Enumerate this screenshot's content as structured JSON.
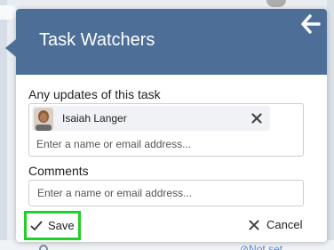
{
  "header": {
    "title": "Task Watchers",
    "back_icon": "arrow-left-icon"
  },
  "watchers": {
    "label": "Any updates of this task",
    "people": [
      {
        "name": "Isaiah Langer",
        "avatar_icon": "user-avatar",
        "remove_icon": "close-icon"
      }
    ],
    "input_placeholder": "Enter a name or email address...",
    "input_value": ""
  },
  "comments": {
    "label": "Comments",
    "placeholder": "Enter a name or email address...",
    "value": ""
  },
  "actions": {
    "save_label": "Save",
    "save_icon": "checkmark-icon",
    "cancel_label": "Cancel",
    "cancel_icon": "close-icon"
  },
  "background": {
    "bottom_link_text": "⊘Not set"
  },
  "colors": {
    "header_bg": "#4d6f97",
    "header_text": "#ffffff",
    "highlight": "#1ed126",
    "chip_bg": "#f0f2f5",
    "border": "#c9cfd6"
  }
}
